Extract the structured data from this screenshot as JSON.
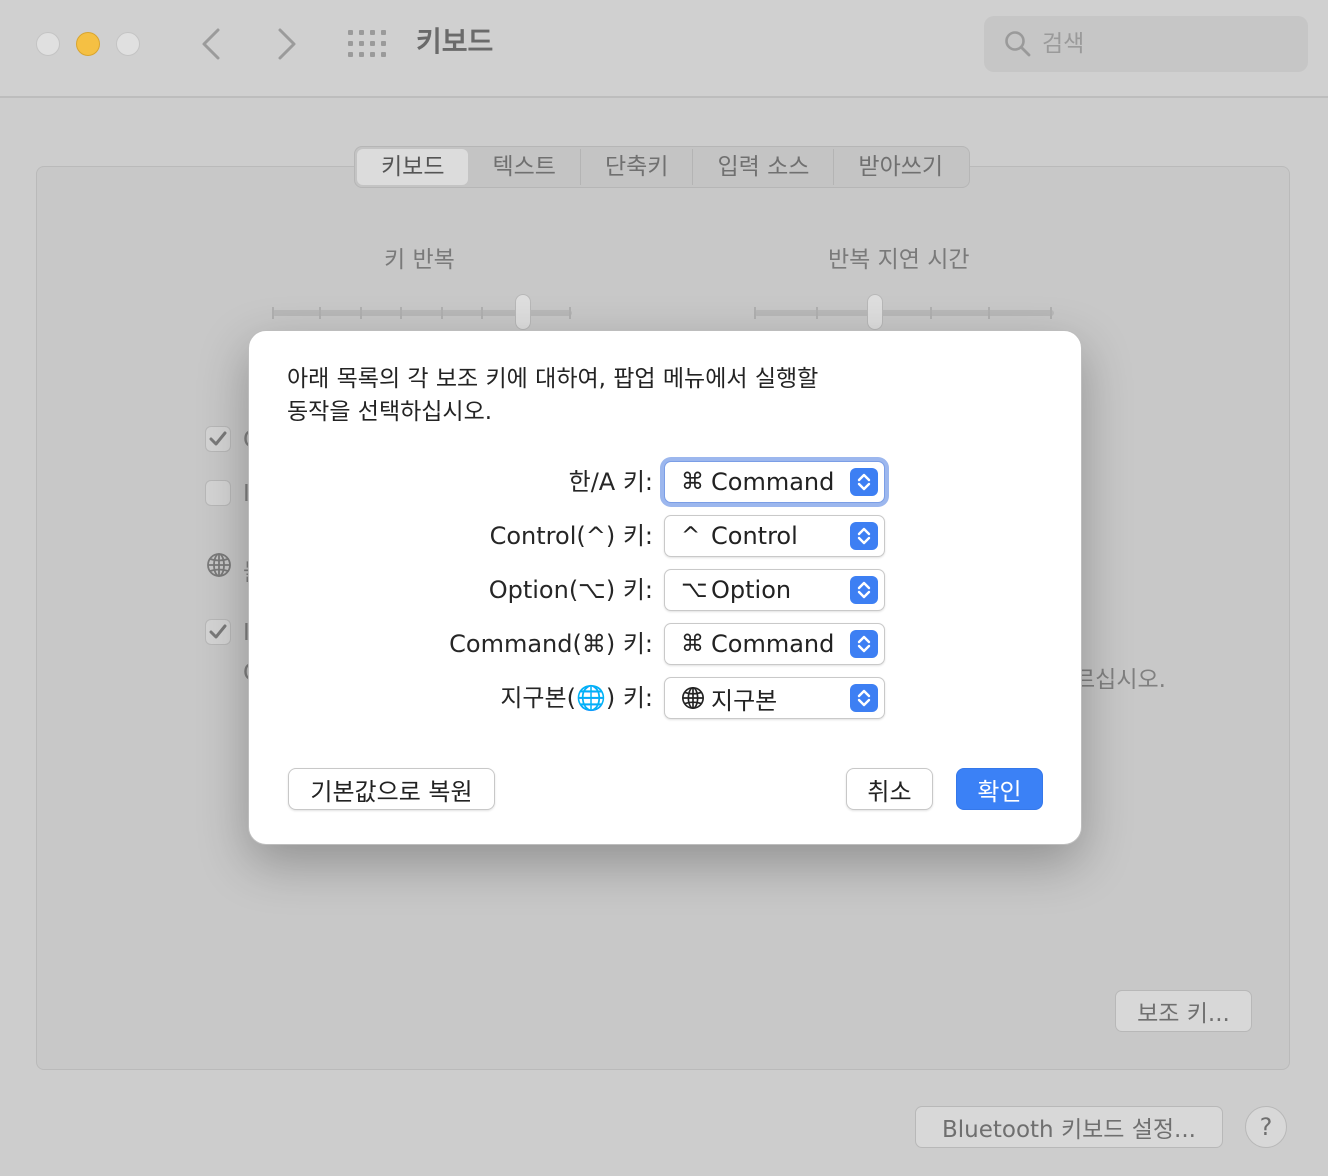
{
  "window": {
    "title": "키보드",
    "search_placeholder": "검색"
  },
  "tabs": [
    "키보드",
    "텍스트",
    "단축키",
    "입력 소스",
    "받아쓰기"
  ],
  "background": {
    "slider_key_repeat": "키 반복",
    "slider_delay": "반복 지연 시간",
    "checkbox_1_checked": true,
    "checkbox_1_label": "C",
    "checkbox_2_checked": false,
    "checkbox_2_label": "I",
    "globe_label": "눌",
    "checkbox_3_checked": true,
    "checkbox_3_label": "I",
    "checkbox_3_sublabel": "C",
    "obscured_text": "르십시오.",
    "modifier_button": "보조 키...",
    "bluetooth_button": "Bluetooth 키보드 설정...",
    "help_button": "?"
  },
  "dialog": {
    "prompt_line1": "아래 목록의 각 보조 키에 대하여, 팝업 메뉴에서 실행할",
    "prompt_line2": "동작을 선택하십시오.",
    "rows": [
      {
        "label": "한/A 키:",
        "symbol": "⌘",
        "value": "Command",
        "icon": "command-symbol"
      },
      {
        "label": "Control(^) 키:",
        "symbol": "^",
        "value": "Control",
        "icon": "control-symbol"
      },
      {
        "label": "Option(⌥) 키:",
        "symbol": "⌥",
        "value": "Option",
        "icon": "option-symbol"
      },
      {
        "label": "Command(⌘) 키:",
        "symbol": "⌘",
        "value": "Command",
        "icon": "command-symbol"
      },
      {
        "label": "지구본(🌐) 키:",
        "symbol": "",
        "value": "지구본",
        "icon": "globe-icon"
      }
    ],
    "restore_button": "기본값으로 복원",
    "cancel_button": "취소",
    "ok_button": "확인"
  },
  "colors": {
    "accent": "#3b81f6",
    "focus_ring": "#9cb7ee",
    "minimize_light": "#f5c043"
  }
}
